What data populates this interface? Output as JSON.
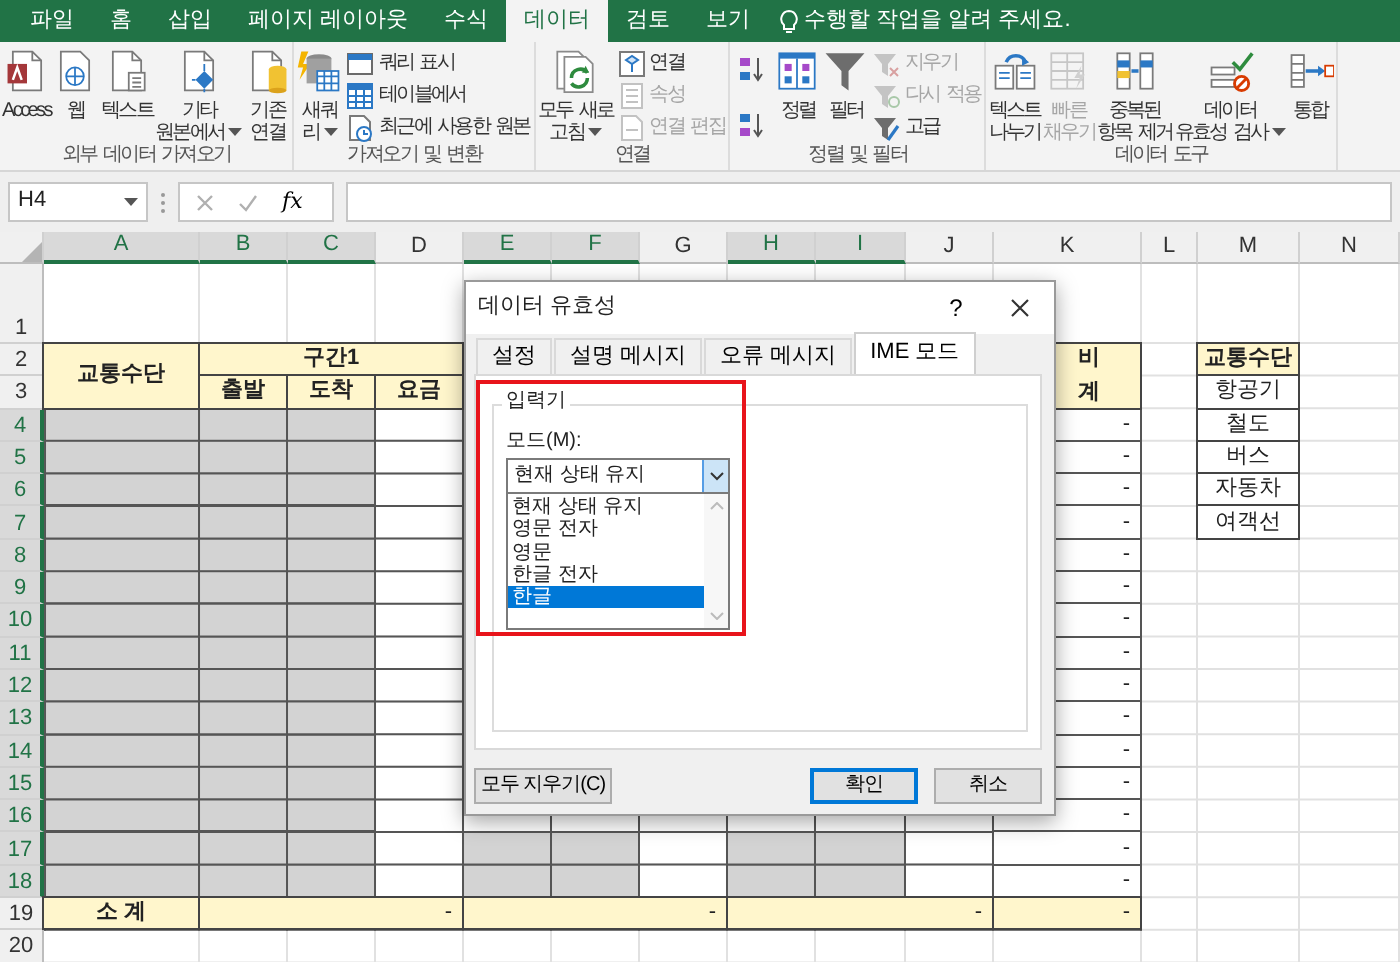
{
  "ribbon_tabs": [
    {
      "label": "파일",
      "selected": false
    },
    {
      "label": "홈",
      "selected": false
    },
    {
      "label": "삽입",
      "selected": false
    },
    {
      "label": "페이지 레이아웃",
      "selected": false
    },
    {
      "label": "수식",
      "selected": false
    },
    {
      "label": "데이터",
      "selected": true
    },
    {
      "label": "검토",
      "selected": false
    },
    {
      "label": "보기",
      "selected": false
    }
  ],
  "tell_me": "수행할 작업을 알려 주세요.",
  "ribbon_groups": [
    {
      "label": "외부 데이터 가져오기",
      "stacks": [
        {
          "buttons": [
            {
              "kind": "large",
              "lines": [
                "Access"
              ],
              "disabled": false,
              "dropdown": false
            }
          ]
        },
        {
          "buttons": [
            {
              "kind": "large",
              "lines": [
                "웹"
              ],
              "disabled": false,
              "dropdown": false
            }
          ]
        },
        {
          "buttons": [
            {
              "kind": "large",
              "lines": [
                "텍스트"
              ],
              "disabled": false,
              "dropdown": false
            }
          ]
        },
        {
          "buttons": [
            {
              "kind": "large",
              "lines": [
                "기타",
                "원본에서"
              ],
              "disabled": false,
              "dropdown": true
            }
          ]
        },
        {
          "buttons": [
            {
              "kind": "large",
              "lines": [
                "기존",
                "연결"
              ],
              "disabled": false,
              "dropdown": false
            }
          ]
        }
      ]
    },
    {
      "label": "가져오기 및 변환",
      "stacks": [
        {
          "buttons": [
            {
              "kind": "large",
              "lines": [
                "새쿼",
                "리"
              ],
              "disabled": false,
              "dropdown": true
            }
          ]
        },
        {
          "buttons": [
            {
              "kind": "small",
              "lines": [
                "쿼리 표시"
              ],
              "disabled": false,
              "dropdown": false
            },
            {
              "kind": "small",
              "lines": [
                "테이블에서"
              ],
              "disabled": false,
              "dropdown": false
            },
            {
              "kind": "small",
              "lines": [
                "최근에 사용한 원본"
              ],
              "disabled": false,
              "dropdown": false
            }
          ]
        }
      ]
    },
    {
      "label": "연결",
      "stacks": [
        {
          "buttons": [
            {
              "kind": "large",
              "lines": [
                "모두 새로",
                "고침"
              ],
              "disabled": false,
              "dropdown": true
            }
          ]
        },
        {
          "buttons": [
            {
              "kind": "small",
              "lines": [
                "연결"
              ],
              "disabled": false,
              "dropdown": false
            },
            {
              "kind": "small",
              "lines": [
                "속성"
              ],
              "disabled": true,
              "dropdown": false
            },
            {
              "kind": "small",
              "lines": [
                "연결 편집"
              ],
              "disabled": true,
              "dropdown": false
            }
          ]
        }
      ]
    },
    {
      "label": "정렬 및 필터",
      "stacks": [
        {
          "buttons": [
            {
              "kind": "icon",
              "disabled": false,
              "dropdown": false
            },
            {
              "kind": "icon",
              "disabled": false,
              "dropdown": false
            }
          ]
        },
        {
          "buttons": [
            {
              "kind": "large",
              "lines": [
                "정렬"
              ],
              "disabled": false,
              "dropdown": false
            }
          ]
        },
        {
          "buttons": [
            {
              "kind": "large",
              "lines": [
                "필터"
              ],
              "disabled": false,
              "dropdown": false
            }
          ]
        },
        {
          "buttons": [
            {
              "kind": "small",
              "lines": [
                "지우기"
              ],
              "disabled": true,
              "dropdown": false
            },
            {
              "kind": "small",
              "lines": [
                "다시 적용"
              ],
              "disabled": true,
              "dropdown": false
            },
            {
              "kind": "small",
              "lines": [
                "고급"
              ],
              "disabled": false,
              "dropdown": false
            }
          ]
        }
      ]
    },
    {
      "label": "데이터 도구",
      "stacks": [
        {
          "buttons": [
            {
              "kind": "large",
              "lines": [
                "텍스트",
                "나누기"
              ],
              "disabled": false,
              "dropdown": false
            }
          ]
        },
        {
          "buttons": [
            {
              "kind": "large",
              "lines": [
                "빠른",
                "채우기"
              ],
              "disabled": true,
              "dropdown": false
            }
          ]
        },
        {
          "buttons": [
            {
              "kind": "large",
              "lines": [
                "중복된",
                "항목 제거"
              ],
              "disabled": false,
              "dropdown": false
            }
          ]
        },
        {
          "buttons": [
            {
              "kind": "large",
              "lines": [
                "데이터",
                "유효성 검사"
              ],
              "disabled": false,
              "dropdown": true
            }
          ]
        },
        {
          "buttons": [
            {
              "kind": "large",
              "lines": [
                "통합"
              ],
              "disabled": false,
              "dropdown": false
            }
          ]
        }
      ]
    }
  ],
  "formula_bar": {
    "name_box": "H4",
    "function_label": "fx"
  },
  "sheet": {
    "columns": [
      {
        "label": "A",
        "selected": true
      },
      {
        "label": "B",
        "selected": true
      },
      {
        "label": "C",
        "selected": true
      },
      {
        "label": "D",
        "selected": false
      },
      {
        "label": "E",
        "selected": true
      },
      {
        "label": "F",
        "selected": true
      },
      {
        "label": "G",
        "selected": false
      },
      {
        "label": "H",
        "selected": true
      },
      {
        "label": "I",
        "selected": true
      },
      {
        "label": "J",
        "selected": false
      },
      {
        "label": "K",
        "selected": false
      },
      {
        "label": "L",
        "selected": false
      },
      {
        "label": "M",
        "selected": false
      },
      {
        "label": "N",
        "selected": false
      }
    ],
    "rows": [
      {
        "label": "1",
        "selected": false
      },
      {
        "label": "2",
        "selected": false
      },
      {
        "label": "3",
        "selected": false
      },
      {
        "label": "4",
        "selected": true
      },
      {
        "label": "5",
        "selected": true
      },
      {
        "label": "6",
        "selected": true
      },
      {
        "label": "7",
        "selected": true
      },
      {
        "label": "8",
        "selected": true
      },
      {
        "label": "9",
        "selected": true
      },
      {
        "label": "10",
        "selected": true
      },
      {
        "label": "11",
        "selected": true
      },
      {
        "label": "12",
        "selected": true
      },
      {
        "label": "13",
        "selected": true
      },
      {
        "label": "14",
        "selected": true
      },
      {
        "label": "15",
        "selected": true
      },
      {
        "label": "16",
        "selected": true
      },
      {
        "label": "17",
        "selected": true
      },
      {
        "label": "18",
        "selected": true
      },
      {
        "label": "19",
        "selected": false
      },
      {
        "label": "20",
        "selected": false
      }
    ],
    "table": {
      "corner": "교통수단",
      "group": "구간1",
      "subheaders": [
        "출발",
        "도착",
        "요금"
      ],
      "total_lines": [
        "비",
        "계"
      ],
      "totals": [
        "-",
        "-",
        "-",
        "-",
        "-",
        "-",
        "-",
        "-",
        "-",
        "-",
        "-",
        "-",
        "-",
        "-",
        "-"
      ],
      "subtotal_label": "소 계",
      "subtotals": [
        "-",
        "-",
        "-",
        "-"
      ]
    },
    "lookup": {
      "header": "교통수단",
      "items": [
        "항공기",
        "철도",
        "버스",
        "자동차",
        "여객선"
      ]
    }
  },
  "dialog": {
    "title": "데이터 유효성",
    "help": "?",
    "tabs": [
      {
        "label": "설정",
        "selected": false
      },
      {
        "label": "설명 메시지",
        "selected": false
      },
      {
        "label": "오류 메시지",
        "selected": false
      },
      {
        "label": "IME 모드",
        "selected": true
      }
    ],
    "group_label": "입력기",
    "mode_label": "모드(M):",
    "mode_value": "현재 상태 유지",
    "options": [
      {
        "label": "현재 상태 유지",
        "selected": false
      },
      {
        "label": "영문 전자",
        "selected": false
      },
      {
        "label": "영문",
        "selected": false
      },
      {
        "label": "한글 전자",
        "selected": false
      },
      {
        "label": "한글",
        "selected": true
      }
    ],
    "clear_button": "모두 지우기(C)",
    "ok_button": "확인",
    "cancel_button": "취소"
  }
}
